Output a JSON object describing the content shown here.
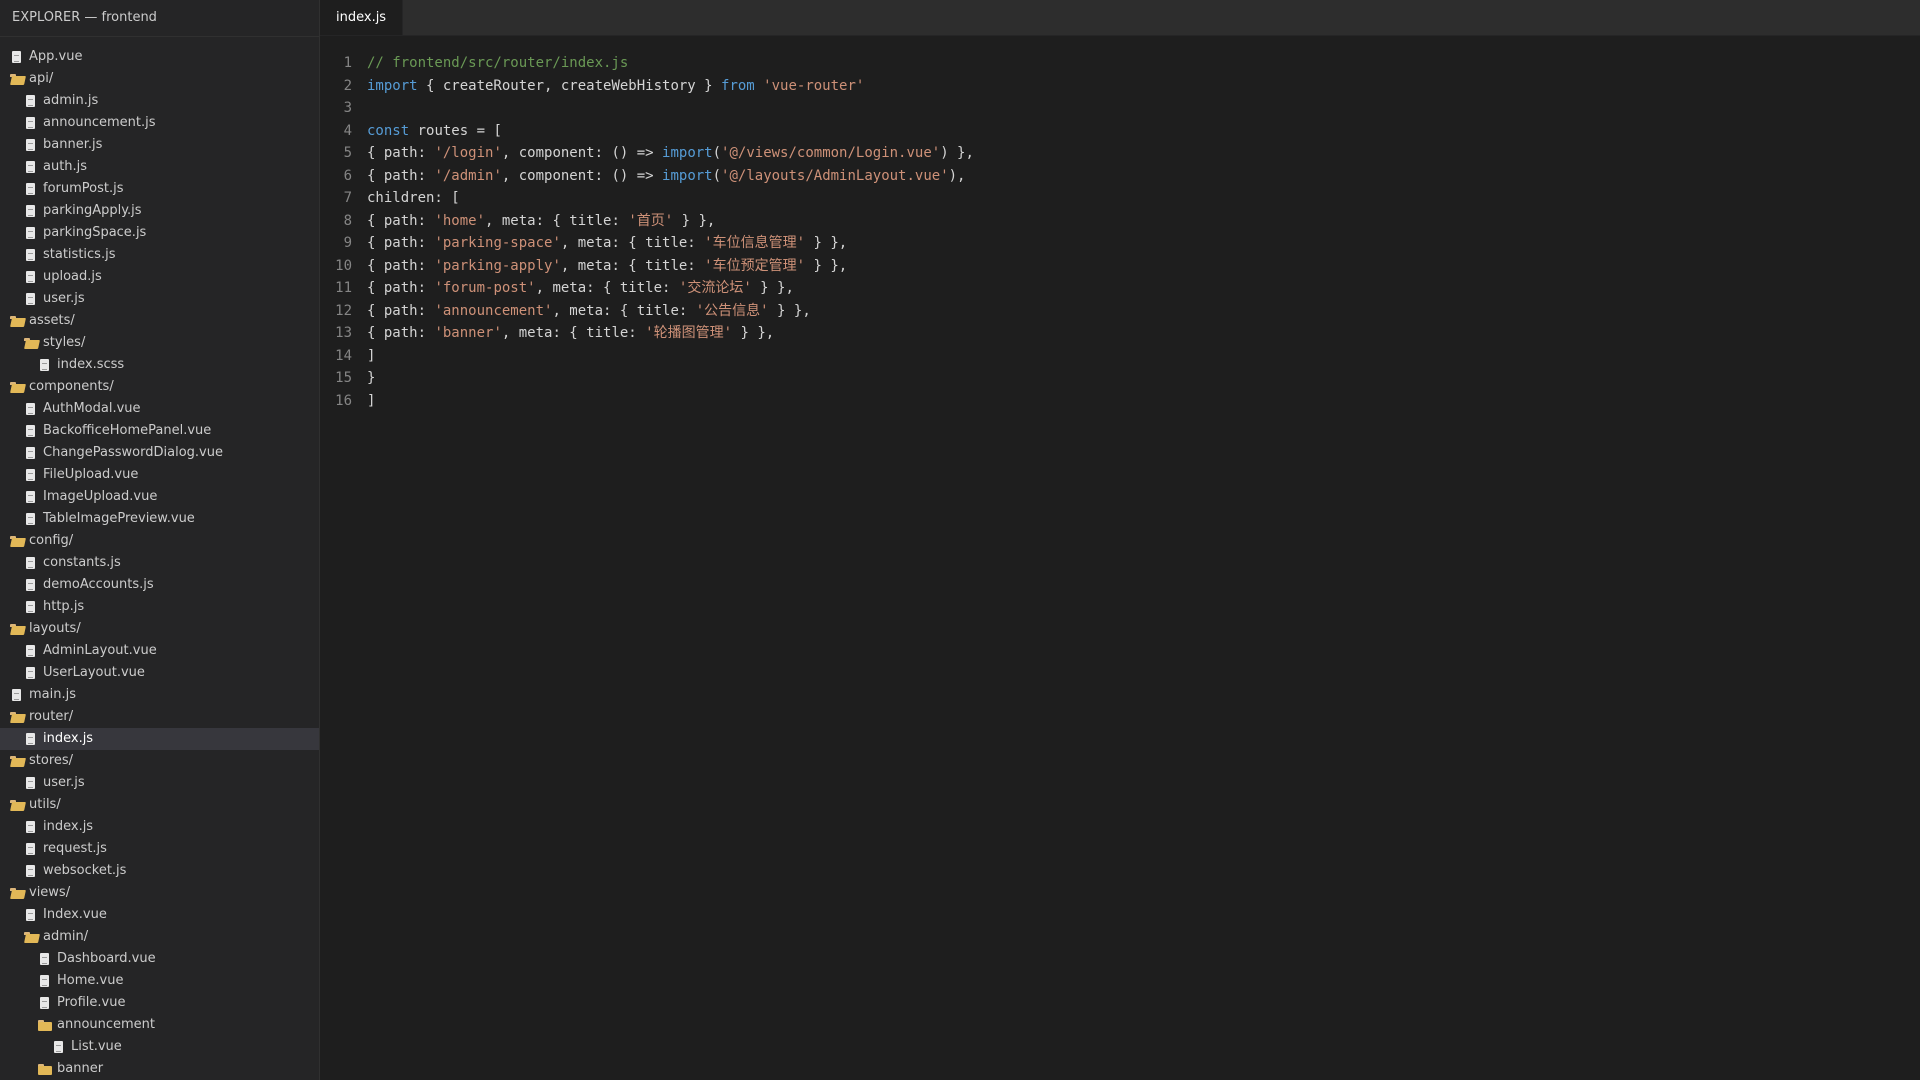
{
  "sidebar": {
    "title": "EXPLORER — frontend",
    "items": [
      {
        "label": "App.vue",
        "type": "file",
        "depth": 0
      },
      {
        "label": "api/",
        "type": "folder-open",
        "depth": 0
      },
      {
        "label": "admin.js",
        "type": "file",
        "depth": 1
      },
      {
        "label": "announcement.js",
        "type": "file",
        "depth": 1
      },
      {
        "label": "banner.js",
        "type": "file",
        "depth": 1
      },
      {
        "label": "auth.js",
        "type": "file",
        "depth": 1
      },
      {
        "label": "forumPost.js",
        "type": "file",
        "depth": 1
      },
      {
        "label": "parkingApply.js",
        "type": "file",
        "depth": 1
      },
      {
        "label": "parkingSpace.js",
        "type": "file",
        "depth": 1
      },
      {
        "label": "statistics.js",
        "type": "file",
        "depth": 1
      },
      {
        "label": "upload.js",
        "type": "file",
        "depth": 1
      },
      {
        "label": "user.js",
        "type": "file",
        "depth": 1
      },
      {
        "label": "assets/",
        "type": "folder-open",
        "depth": 0
      },
      {
        "label": "styles/",
        "type": "folder-open",
        "depth": 1
      },
      {
        "label": "index.scss",
        "type": "file",
        "depth": 2
      },
      {
        "label": "components/",
        "type": "folder-open",
        "depth": 0
      },
      {
        "label": "AuthModal.vue",
        "type": "file",
        "depth": 1
      },
      {
        "label": "BackofficeHomePanel.vue",
        "type": "file",
        "depth": 1
      },
      {
        "label": "ChangePasswordDialog.vue",
        "type": "file",
        "depth": 1
      },
      {
        "label": "FileUpload.vue",
        "type": "file",
        "depth": 1
      },
      {
        "label": "ImageUpload.vue",
        "type": "file",
        "depth": 1
      },
      {
        "label": "TableImagePreview.vue",
        "type": "file",
        "depth": 1
      },
      {
        "label": "config/",
        "type": "folder-open",
        "depth": 0
      },
      {
        "label": "constants.js",
        "type": "file",
        "depth": 1
      },
      {
        "label": "demoAccounts.js",
        "type": "file",
        "depth": 1
      },
      {
        "label": "http.js",
        "type": "file",
        "depth": 1
      },
      {
        "label": "layouts/",
        "type": "folder-open",
        "depth": 0
      },
      {
        "label": "AdminLayout.vue",
        "type": "file",
        "depth": 1
      },
      {
        "label": "UserLayout.vue",
        "type": "file",
        "depth": 1
      },
      {
        "label": "main.js",
        "type": "file",
        "depth": 0
      },
      {
        "label": "router/",
        "type": "folder-open",
        "depth": 0
      },
      {
        "label": "index.js",
        "type": "file",
        "depth": 1,
        "selected": true
      },
      {
        "label": "stores/",
        "type": "folder-open",
        "depth": 0
      },
      {
        "label": "user.js",
        "type": "file",
        "depth": 1
      },
      {
        "label": "utils/",
        "type": "folder-open",
        "depth": 0
      },
      {
        "label": "index.js",
        "type": "file",
        "depth": 1
      },
      {
        "label": "request.js",
        "type": "file",
        "depth": 1
      },
      {
        "label": "websocket.js",
        "type": "file",
        "depth": 1
      },
      {
        "label": "views/",
        "type": "folder-open",
        "depth": 0
      },
      {
        "label": "Index.vue",
        "type": "file",
        "depth": 1
      },
      {
        "label": "admin/",
        "type": "folder-open",
        "depth": 1
      },
      {
        "label": "Dashboard.vue",
        "type": "file",
        "depth": 2
      },
      {
        "label": "Home.vue",
        "type": "file",
        "depth": 2
      },
      {
        "label": "Profile.vue",
        "type": "file",
        "depth": 2
      },
      {
        "label": "announcement",
        "type": "folder",
        "depth": 2
      },
      {
        "label": "List.vue",
        "type": "file",
        "depth": 3
      },
      {
        "label": "banner",
        "type": "folder",
        "depth": 2
      }
    ]
  },
  "tabs": [
    {
      "label": "index.js",
      "active": true
    }
  ],
  "code": {
    "lines": [
      [
        {
          "t": "// frontend/src/router/index.js",
          "k": "com"
        }
      ],
      [
        {
          "t": "import",
          "k": "kw"
        },
        {
          "t": " { createRouter, createWebHistory } ",
          "k": "plain"
        },
        {
          "t": "from",
          "k": "kw"
        },
        {
          "t": " ",
          "k": "plain"
        },
        {
          "t": "'vue-router'",
          "k": "str"
        }
      ],
      [],
      [
        {
          "t": "const",
          "k": "kw"
        },
        {
          "t": " routes = [",
          "k": "plain"
        }
      ],
      [
        {
          "t": "{ path: ",
          "k": "plain"
        },
        {
          "t": "'/login'",
          "k": "str"
        },
        {
          "t": ", component: () => ",
          "k": "plain"
        },
        {
          "t": "import",
          "k": "kw"
        },
        {
          "t": "(",
          "k": "plain"
        },
        {
          "t": "'@/views/common/Login.vue'",
          "k": "str"
        },
        {
          "t": ") },",
          "k": "plain"
        }
      ],
      [
        {
          "t": "{ path: ",
          "k": "plain"
        },
        {
          "t": "'/admin'",
          "k": "str"
        },
        {
          "t": ", component: () => ",
          "k": "plain"
        },
        {
          "t": "import",
          "k": "kw"
        },
        {
          "t": "(",
          "k": "plain"
        },
        {
          "t": "'@/layouts/AdminLayout.vue'",
          "k": "str"
        },
        {
          "t": "),",
          "k": "plain"
        }
      ],
      [
        {
          "t": "children: [",
          "k": "plain"
        }
      ],
      [
        {
          "t": "{ path: ",
          "k": "plain"
        },
        {
          "t": "'home'",
          "k": "str"
        },
        {
          "t": ", meta: { title: ",
          "k": "plain"
        },
        {
          "t": "'首页'",
          "k": "str"
        },
        {
          "t": " } },",
          "k": "plain"
        }
      ],
      [
        {
          "t": "{ path: ",
          "k": "plain"
        },
        {
          "t": "'parking-space'",
          "k": "str"
        },
        {
          "t": ", meta: { title: ",
          "k": "plain"
        },
        {
          "t": "'车位信息管理'",
          "k": "str"
        },
        {
          "t": " } },",
          "k": "plain"
        }
      ],
      [
        {
          "t": "{ path: ",
          "k": "plain"
        },
        {
          "t": "'parking-apply'",
          "k": "str"
        },
        {
          "t": ", meta: { title: ",
          "k": "plain"
        },
        {
          "t": "'车位预定管理'",
          "k": "str"
        },
        {
          "t": " } },",
          "k": "plain"
        }
      ],
      [
        {
          "t": "{ path: ",
          "k": "plain"
        },
        {
          "t": "'forum-post'",
          "k": "str"
        },
        {
          "t": ", meta: { title: ",
          "k": "plain"
        },
        {
          "t": "'交流论坛'",
          "k": "str"
        },
        {
          "t": " } },",
          "k": "plain"
        }
      ],
      [
        {
          "t": "{ path: ",
          "k": "plain"
        },
        {
          "t": "'announcement'",
          "k": "str"
        },
        {
          "t": ", meta: { title: ",
          "k": "plain"
        },
        {
          "t": "'公告信息'",
          "k": "str"
        },
        {
          "t": " } },",
          "k": "plain"
        }
      ],
      [
        {
          "t": "{ path: ",
          "k": "plain"
        },
        {
          "t": "'banner'",
          "k": "str"
        },
        {
          "t": ", meta: { title: ",
          "k": "plain"
        },
        {
          "t": "'轮播图管理'",
          "k": "str"
        },
        {
          "t": " } },",
          "k": "plain"
        }
      ],
      [
        {
          "t": "]",
          "k": "plain"
        }
      ],
      [
        {
          "t": "}",
          "k": "plain"
        }
      ],
      [
        {
          "t": "]",
          "k": "plain"
        }
      ]
    ]
  },
  "colors": {
    "keyword": "#569cd6",
    "string": "#ce9178",
    "comment": "#6a9955",
    "text": "#d4d4d4",
    "line_number": "#858585",
    "selection": "#37373d"
  }
}
